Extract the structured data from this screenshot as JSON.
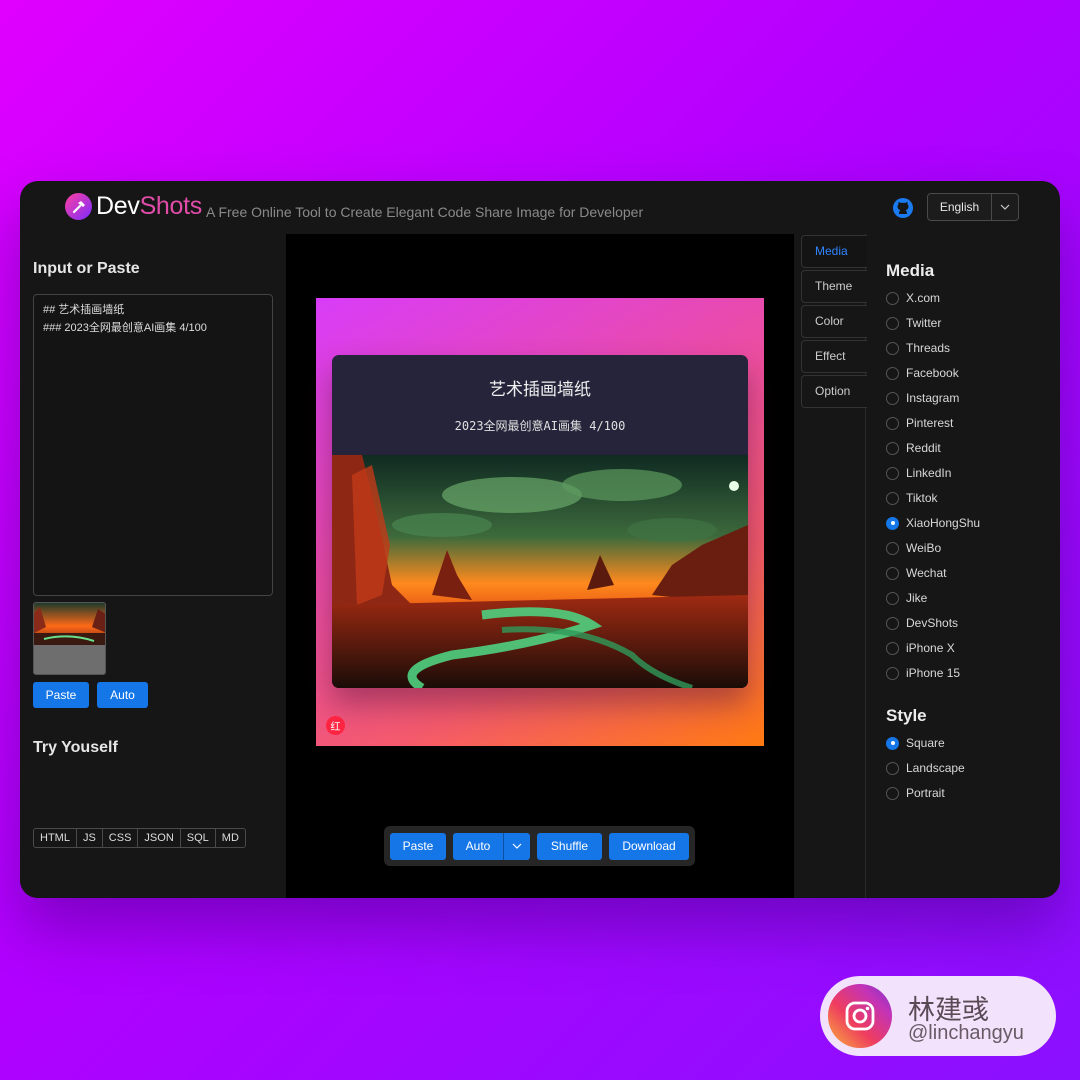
{
  "header": {
    "logo_dev": "Dev",
    "logo_shots": "Shots",
    "tagline": "A Free Online Tool to Create Elegant Code Share Image for Developer",
    "language": "English"
  },
  "left": {
    "input_title": "Input or Paste",
    "input_value": "## 艺术插画墙纸\n### 2023全网最创意AI画集 4/100",
    "paste_label": "Paste",
    "auto_label": "Auto",
    "try_title": "Try Youself",
    "samples": [
      "HTML",
      "JS",
      "CSS",
      "JSON",
      "SQL",
      "MD"
    ]
  },
  "preview": {
    "card_title": "艺术插画墙纸",
    "card_subtitle": "2023全网最创意AI画集 4/100",
    "badge": "红"
  },
  "toolbar": {
    "paste": "Paste",
    "auto": "Auto",
    "shuffle": "Shuffle",
    "download": "Download"
  },
  "tabs": [
    "Media",
    "Theme",
    "Color",
    "Effect",
    "Option"
  ],
  "active_tab": "Media",
  "media": {
    "title": "Media",
    "options": [
      "X.com",
      "Twitter",
      "Threads",
      "Facebook",
      "Instagram",
      "Pinterest",
      "Reddit",
      "LinkedIn",
      "Tiktok",
      "XiaoHongShu",
      "WeiBo",
      "Wechat",
      "Jike",
      "DevShots",
      "iPhone X",
      "iPhone 15"
    ],
    "selected": "XiaoHongShu"
  },
  "style": {
    "title": "Style",
    "options": [
      "Square",
      "Landscape",
      "Portrait"
    ],
    "selected": "Square"
  },
  "profile": {
    "name": "林建彧",
    "handle": "@linchangyu"
  },
  "colors": {
    "accent": "#1576e8",
    "logo_pink": "#e14ca8",
    "app_bg": "#161616"
  }
}
